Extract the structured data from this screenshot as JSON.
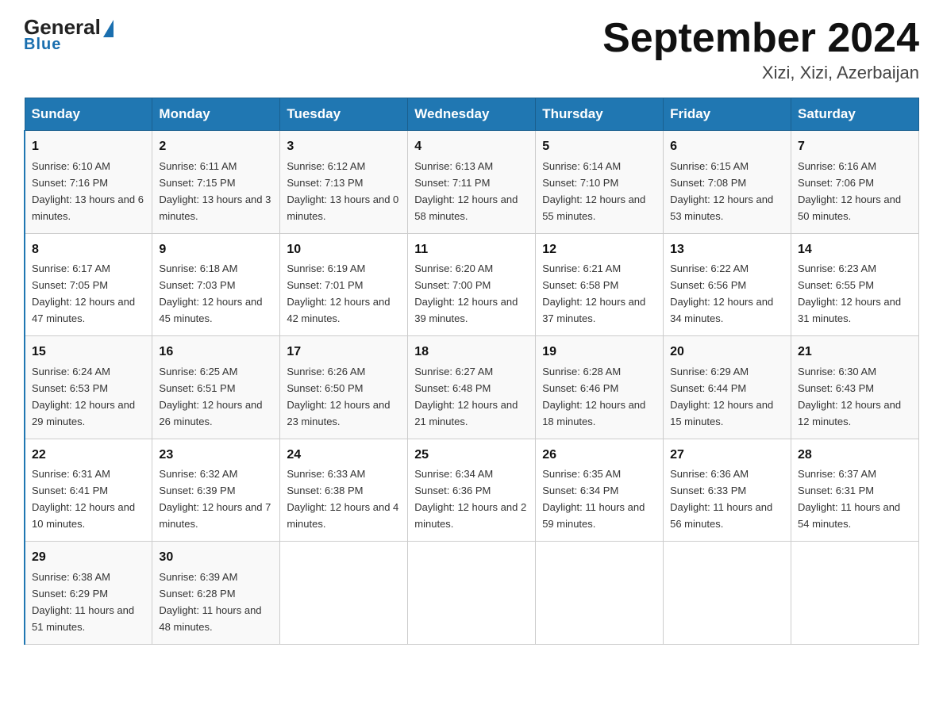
{
  "header": {
    "logo_general": "General",
    "logo_blue": "Blue",
    "month_year": "September 2024",
    "location": "Xizi, Xizi, Azerbaijan"
  },
  "weekdays": [
    "Sunday",
    "Monday",
    "Tuesday",
    "Wednesday",
    "Thursday",
    "Friday",
    "Saturday"
  ],
  "weeks": [
    [
      {
        "day": "1",
        "sunrise": "6:10 AM",
        "sunset": "7:16 PM",
        "daylight": "13 hours and 6 minutes."
      },
      {
        "day": "2",
        "sunrise": "6:11 AM",
        "sunset": "7:15 PM",
        "daylight": "13 hours and 3 minutes."
      },
      {
        "day": "3",
        "sunrise": "6:12 AM",
        "sunset": "7:13 PM",
        "daylight": "13 hours and 0 minutes."
      },
      {
        "day": "4",
        "sunrise": "6:13 AM",
        "sunset": "7:11 PM",
        "daylight": "12 hours and 58 minutes."
      },
      {
        "day": "5",
        "sunrise": "6:14 AM",
        "sunset": "7:10 PM",
        "daylight": "12 hours and 55 minutes."
      },
      {
        "day": "6",
        "sunrise": "6:15 AM",
        "sunset": "7:08 PM",
        "daylight": "12 hours and 53 minutes."
      },
      {
        "day": "7",
        "sunrise": "6:16 AM",
        "sunset": "7:06 PM",
        "daylight": "12 hours and 50 minutes."
      }
    ],
    [
      {
        "day": "8",
        "sunrise": "6:17 AM",
        "sunset": "7:05 PM",
        "daylight": "12 hours and 47 minutes."
      },
      {
        "day": "9",
        "sunrise": "6:18 AM",
        "sunset": "7:03 PM",
        "daylight": "12 hours and 45 minutes."
      },
      {
        "day": "10",
        "sunrise": "6:19 AM",
        "sunset": "7:01 PM",
        "daylight": "12 hours and 42 minutes."
      },
      {
        "day": "11",
        "sunrise": "6:20 AM",
        "sunset": "7:00 PM",
        "daylight": "12 hours and 39 minutes."
      },
      {
        "day": "12",
        "sunrise": "6:21 AM",
        "sunset": "6:58 PM",
        "daylight": "12 hours and 37 minutes."
      },
      {
        "day": "13",
        "sunrise": "6:22 AM",
        "sunset": "6:56 PM",
        "daylight": "12 hours and 34 minutes."
      },
      {
        "day": "14",
        "sunrise": "6:23 AM",
        "sunset": "6:55 PM",
        "daylight": "12 hours and 31 minutes."
      }
    ],
    [
      {
        "day": "15",
        "sunrise": "6:24 AM",
        "sunset": "6:53 PM",
        "daylight": "12 hours and 29 minutes."
      },
      {
        "day": "16",
        "sunrise": "6:25 AM",
        "sunset": "6:51 PM",
        "daylight": "12 hours and 26 minutes."
      },
      {
        "day": "17",
        "sunrise": "6:26 AM",
        "sunset": "6:50 PM",
        "daylight": "12 hours and 23 minutes."
      },
      {
        "day": "18",
        "sunrise": "6:27 AM",
        "sunset": "6:48 PM",
        "daylight": "12 hours and 21 minutes."
      },
      {
        "day": "19",
        "sunrise": "6:28 AM",
        "sunset": "6:46 PM",
        "daylight": "12 hours and 18 minutes."
      },
      {
        "day": "20",
        "sunrise": "6:29 AM",
        "sunset": "6:44 PM",
        "daylight": "12 hours and 15 minutes."
      },
      {
        "day": "21",
        "sunrise": "6:30 AM",
        "sunset": "6:43 PM",
        "daylight": "12 hours and 12 minutes."
      }
    ],
    [
      {
        "day": "22",
        "sunrise": "6:31 AM",
        "sunset": "6:41 PM",
        "daylight": "12 hours and 10 minutes."
      },
      {
        "day": "23",
        "sunrise": "6:32 AM",
        "sunset": "6:39 PM",
        "daylight": "12 hours and 7 minutes."
      },
      {
        "day": "24",
        "sunrise": "6:33 AM",
        "sunset": "6:38 PM",
        "daylight": "12 hours and 4 minutes."
      },
      {
        "day": "25",
        "sunrise": "6:34 AM",
        "sunset": "6:36 PM",
        "daylight": "12 hours and 2 minutes."
      },
      {
        "day": "26",
        "sunrise": "6:35 AM",
        "sunset": "6:34 PM",
        "daylight": "11 hours and 59 minutes."
      },
      {
        "day": "27",
        "sunrise": "6:36 AM",
        "sunset": "6:33 PM",
        "daylight": "11 hours and 56 minutes."
      },
      {
        "day": "28",
        "sunrise": "6:37 AM",
        "sunset": "6:31 PM",
        "daylight": "11 hours and 54 minutes."
      }
    ],
    [
      {
        "day": "29",
        "sunrise": "6:38 AM",
        "sunset": "6:29 PM",
        "daylight": "11 hours and 51 minutes."
      },
      {
        "day": "30",
        "sunrise": "6:39 AM",
        "sunset": "6:28 PM",
        "daylight": "11 hours and 48 minutes."
      },
      null,
      null,
      null,
      null,
      null
    ]
  ],
  "labels": {
    "sunrise": "Sunrise: ",
    "sunset": "Sunset: ",
    "daylight": "Daylight: "
  }
}
